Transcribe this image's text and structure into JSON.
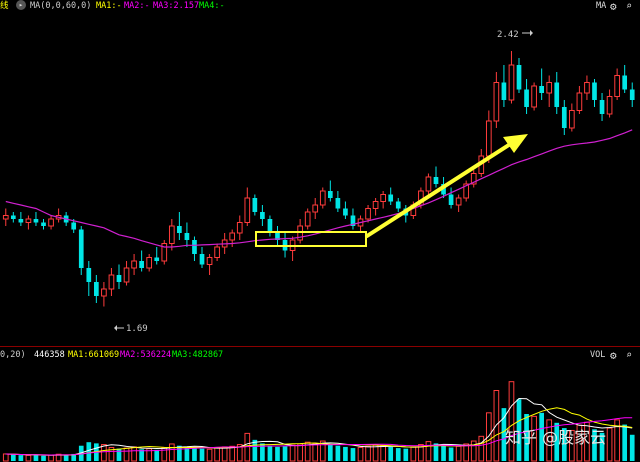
{
  "price_header": {
    "left_glyph": "线",
    "circle_icon_label": "▸",
    "indicator": "MA(0,0,60,0)",
    "ma1": "MA1:-",
    "ma2": "MA2:-",
    "ma3": "MA3:2.157",
    "ma4": "MA4:-",
    "right_label": "MA"
  },
  "volume_header": {
    "indicator": "0,20)",
    "vol_value": "446358",
    "ma1": "MA1:661069",
    "ma2": "MA2:536224",
    "ma3": "MA3:482867",
    "right_label": "VOL"
  },
  "annotations": {
    "high_label": "2.42",
    "low_label": "1.69"
  },
  "watermark": "知乎 @股家云",
  "colors": {
    "background": "#000000",
    "up": "#ff3c3c",
    "down": "#00e6e6",
    "ma_line": "#d020d0",
    "highlight_box": "#ffff33",
    "arrow": "#ffff33",
    "ma1_text": "#ffff00",
    "ma2_text": "#ff00ff",
    "ma3_text": "#00ff00",
    "vol_ma1": "#ffffff",
    "vol_ma2": "#ffff00",
    "vol_ma3": "#ff00ff"
  },
  "chart_data": {
    "type": "candlestick",
    "price_scale": [
      1.6,
      2.5
    ],
    "candles": [
      [
        1.94,
        1.97,
        1.92,
        1.95
      ],
      [
        1.95,
        1.96,
        1.93,
        1.94
      ],
      [
        1.94,
        1.96,
        1.92,
        1.93
      ],
      [
        1.93,
        1.95,
        1.91,
        1.94
      ],
      [
        1.94,
        1.96,
        1.92,
        1.93
      ],
      [
        1.93,
        1.94,
        1.91,
        1.92
      ],
      [
        1.92,
        1.95,
        1.91,
        1.94
      ],
      [
        1.94,
        1.97,
        1.93,
        1.95
      ],
      [
        1.95,
        1.96,
        1.92,
        1.93
      ],
      [
        1.93,
        1.94,
        1.9,
        1.91
      ],
      [
        1.91,
        1.92,
        1.78,
        1.8
      ],
      [
        1.8,
        1.82,
        1.72,
        1.76
      ],
      [
        1.76,
        1.78,
        1.7,
        1.72
      ],
      [
        1.72,
        1.76,
        1.69,
        1.74
      ],
      [
        1.74,
        1.8,
        1.72,
        1.78
      ],
      [
        1.78,
        1.81,
        1.74,
        1.76
      ],
      [
        1.76,
        1.82,
        1.75,
        1.8
      ],
      [
        1.8,
        1.84,
        1.78,
        1.82
      ],
      [
        1.82,
        1.85,
        1.79,
        1.8
      ],
      [
        1.8,
        1.84,
        1.79,
        1.83
      ],
      [
        1.83,
        1.86,
        1.81,
        1.82
      ],
      [
        1.82,
        1.88,
        1.81,
        1.87
      ],
      [
        1.87,
        1.94,
        1.85,
        1.92
      ],
      [
        1.92,
        1.96,
        1.88,
        1.9
      ],
      [
        1.9,
        1.93,
        1.86,
        1.88
      ],
      [
        1.88,
        1.89,
        1.82,
        1.84
      ],
      [
        1.84,
        1.86,
        1.8,
        1.81
      ],
      [
        1.81,
        1.84,
        1.78,
        1.83
      ],
      [
        1.83,
        1.87,
        1.82,
        1.86
      ],
      [
        1.86,
        1.9,
        1.84,
        1.88
      ],
      [
        1.88,
        1.91,
        1.86,
        1.9
      ],
      [
        1.9,
        1.95,
        1.88,
        1.93
      ],
      [
        1.93,
        2.03,
        1.92,
        2.0
      ],
      [
        2.0,
        2.01,
        1.95,
        1.96
      ],
      [
        1.96,
        1.98,
        1.92,
        1.94
      ],
      [
        1.94,
        1.95,
        1.89,
        1.9
      ],
      [
        1.9,
        1.92,
        1.86,
        1.88
      ],
      [
        1.88,
        1.9,
        1.83,
        1.85
      ],
      [
        1.85,
        1.89,
        1.82,
        1.88
      ],
      [
        1.88,
        1.94,
        1.87,
        1.92
      ],
      [
        1.92,
        1.97,
        1.91,
        1.96
      ],
      [
        1.96,
        2.0,
        1.94,
        1.98
      ],
      [
        1.98,
        2.03,
        1.97,
        2.02
      ],
      [
        2.02,
        2.05,
        1.99,
        2.0
      ],
      [
        2.0,
        2.02,
        1.96,
        1.97
      ],
      [
        1.97,
        1.99,
        1.94,
        1.95
      ],
      [
        1.95,
        1.97,
        1.91,
        1.92
      ],
      [
        1.92,
        1.95,
        1.9,
        1.94
      ],
      [
        1.94,
        1.98,
        1.93,
        1.97
      ],
      [
        1.97,
        2.0,
        1.95,
        1.99
      ],
      [
        1.99,
        2.02,
        1.97,
        2.01
      ],
      [
        2.01,
        2.03,
        1.98,
        1.99
      ],
      [
        1.99,
        2.0,
        1.96,
        1.97
      ],
      [
        1.97,
        1.98,
        1.93,
        1.95
      ],
      [
        1.95,
        1.99,
        1.94,
        1.98
      ],
      [
        1.98,
        2.03,
        1.97,
        2.02
      ],
      [
        2.02,
        2.07,
        2.01,
        2.06
      ],
      [
        2.06,
        2.09,
        2.03,
        2.04
      ],
      [
        2.04,
        2.06,
        2.0,
        2.01
      ],
      [
        2.01,
        2.03,
        1.97,
        1.98
      ],
      [
        1.98,
        2.01,
        1.96,
        2.0
      ],
      [
        2.0,
        2.05,
        1.99,
        2.04
      ],
      [
        2.04,
        2.08,
        2.03,
        2.07
      ],
      [
        2.07,
        2.14,
        2.06,
        2.12
      ],
      [
        2.12,
        2.25,
        2.1,
        2.22
      ],
      [
        2.22,
        2.36,
        2.2,
        2.33
      ],
      [
        2.33,
        2.38,
        2.26,
        2.28
      ],
      [
        2.28,
        2.42,
        2.27,
        2.38
      ],
      [
        2.38,
        2.4,
        2.3,
        2.31
      ],
      [
        2.31,
        2.34,
        2.24,
        2.26
      ],
      [
        2.26,
        2.33,
        2.25,
        2.32
      ],
      [
        2.32,
        2.37,
        2.28,
        2.3
      ],
      [
        2.3,
        2.35,
        2.26,
        2.33
      ],
      [
        2.33,
        2.36,
        2.24,
        2.26
      ],
      [
        2.26,
        2.28,
        2.18,
        2.2
      ],
      [
        2.2,
        2.27,
        2.19,
        2.25
      ],
      [
        2.25,
        2.32,
        2.24,
        2.3
      ],
      [
        2.3,
        2.35,
        2.28,
        2.33
      ],
      [
        2.33,
        2.34,
        2.26,
        2.28
      ],
      [
        2.28,
        2.3,
        2.22,
        2.24
      ],
      [
        2.24,
        2.31,
        2.23,
        2.29
      ],
      [
        2.29,
        2.37,
        2.28,
        2.35
      ],
      [
        2.35,
        2.38,
        2.3,
        2.31
      ],
      [
        2.31,
        2.33,
        2.26,
        2.28
      ]
    ],
    "ma_line": [
      1.99,
      1.985,
      1.98,
      1.975,
      1.97,
      1.96,
      1.95,
      1.945,
      1.94,
      1.935,
      1.93,
      1.925,
      1.92,
      1.915,
      1.905,
      1.895,
      1.89,
      1.885,
      1.878,
      1.872,
      1.866,
      1.86,
      1.86,
      1.862,
      1.865,
      1.865,
      1.866,
      1.867,
      1.868,
      1.869,
      1.87,
      1.872,
      1.875,
      1.878,
      1.88,
      1.882,
      1.883,
      1.884,
      1.885,
      1.888,
      1.892,
      1.897,
      1.903,
      1.909,
      1.915,
      1.92,
      1.925,
      1.93,
      1.935,
      1.94,
      1.945,
      1.95,
      1.956,
      1.963,
      1.97,
      1.978,
      1.986,
      1.995,
      2.005,
      2.015,
      2.025,
      2.035,
      2.045,
      2.055,
      2.065,
      2.075,
      2.085,
      2.095,
      2.103,
      2.11,
      2.118,
      2.126,
      2.134,
      2.142,
      2.148,
      2.152,
      2.155,
      2.157,
      2.16,
      2.165,
      2.17,
      2.178,
      2.186,
      2.195
    ],
    "volume_scale": [
      0,
      1600000
    ],
    "volumes": [
      120000,
      110000,
      100000,
      95000,
      105000,
      90000,
      100000,
      115000,
      95000,
      120000,
      260000,
      320000,
      300000,
      280000,
      230000,
      210000,
      220000,
      240000,
      200000,
      210000,
      190000,
      230000,
      290000,
      260000,
      240000,
      230000,
      210000,
      200000,
      220000,
      240000,
      250000,
      280000,
      470000,
      360000,
      300000,
      260000,
      240000,
      250000,
      270000,
      290000,
      320000,
      300000,
      340000,
      290000,
      260000,
      240000,
      220000,
      230000,
      250000,
      270000,
      260000,
      240000,
      220000,
      210000,
      240000,
      280000,
      330000,
      300000,
      260000,
      230000,
      250000,
      290000,
      340000,
      420000,
      820000,
      1200000,
      900000,
      1350000,
      1050000,
      800000,
      760000,
      820000,
      700000,
      650000,
      560000,
      520000,
      610000,
      660000,
      540000,
      480000,
      560000,
      700000,
      620000,
      446358
    ],
    "vol_ma_lines": {
      "MA1": [],
      "MA2": [],
      "MA3": []
    }
  }
}
